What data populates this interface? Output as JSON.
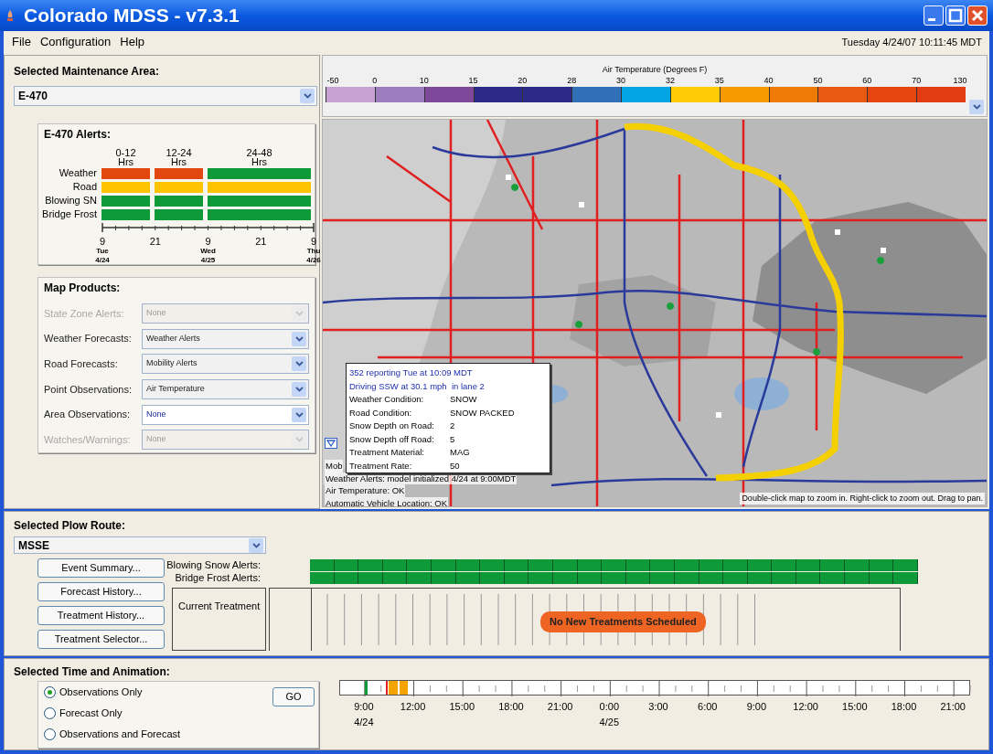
{
  "window": {
    "title": "Colorado MDSS - v7.3.1"
  },
  "menu": [
    "File",
    "Configuration",
    "Help"
  ],
  "datetime": "Tuesday 4/24/07 10:11:45 MDT",
  "maintenance_area": {
    "label": "Selected Maintenance Area:",
    "value": "E-470"
  },
  "alerts": {
    "title": "E-470 Alerts:",
    "columns": [
      {
        "range": "0-12",
        "unit": "Hrs"
      },
      {
        "range": "12-24",
        "unit": "Hrs"
      },
      {
        "range": "24-48",
        "unit": "Hrs"
      }
    ],
    "rows": [
      {
        "label": "Weather",
        "cells": [
          {
            "color": "#e2470f"
          },
          {
            "color": "#e2470f"
          },
          {
            "color": "#0f9a3a"
          }
        ]
      },
      {
        "label": "Road",
        "cells": [
          {
            "color": "#ffc400"
          },
          {
            "color": "#ffc400"
          },
          {
            "color": "#ffc400"
          }
        ]
      },
      {
        "label": "Blowing SN",
        "cells": [
          {
            "color": "#0f9a3a"
          },
          {
            "color": "#0f9a3a"
          },
          {
            "color": "#0f9a3a"
          }
        ]
      },
      {
        "label": "Bridge Frost",
        "cells": [
          {
            "color": "#0f9a3a"
          },
          {
            "color": "#0f9a3a"
          },
          {
            "color": "#0f9a3a"
          }
        ]
      }
    ],
    "axis": [
      {
        "hour": "9",
        "day": "Tue",
        "date": "4/24"
      },
      {
        "hour": "21"
      },
      {
        "hour": "9",
        "day": "Wed",
        "date": "4/25"
      },
      {
        "hour": "21"
      },
      {
        "hour": "9",
        "day": "Thu",
        "date": "4/26"
      }
    ]
  },
  "map_products": {
    "title": "Map Products:",
    "rows": [
      {
        "label": "State Zone Alerts:",
        "value": "None",
        "disabled": true,
        "focused": false
      },
      {
        "label": "Weather Forecasts:",
        "value": "Weather Alerts",
        "disabled": false,
        "focused": false
      },
      {
        "label": "Road Forecasts:",
        "value": "Mobility Alerts",
        "disabled": false,
        "focused": false
      },
      {
        "label": "Point Observations:",
        "value": "Air Temperature",
        "disabled": false,
        "focused": false
      },
      {
        "label": "Area Observations:",
        "value": "None",
        "disabled": false,
        "focused": true
      },
      {
        "label": "Watches/Warnings:",
        "value": "None",
        "disabled": true,
        "focused": false
      }
    ]
  },
  "legend": {
    "title": "Air Temperature (Degrees F)",
    "ticks": [
      "-50",
      "0",
      "10",
      "15",
      "20",
      "28",
      "30",
      "32",
      "35",
      "40",
      "50",
      "60",
      "70",
      "130"
    ],
    "bands": [
      {
        "color": "#c7a3d3"
      },
      {
        "color": "#9c7cbd"
      },
      {
        "color": "#7e489b"
      },
      {
        "color": "#2c2a88"
      },
      {
        "color": "#2c2a88"
      },
      {
        "color": "#3170b8"
      },
      {
        "color": "#03a6e2"
      },
      {
        "color": "#ffcb05"
      },
      {
        "color": "#f59a00"
      },
      {
        "color": "#ef7a05"
      },
      {
        "color": "#ea5a12"
      },
      {
        "color": "#e54610"
      },
      {
        "color": "#e23d12"
      }
    ]
  },
  "map": {
    "tooltip": {
      "header": [
        "352 reporting Tue at 10:09 MDT",
        "Driving SSW at 30.1 mph  in lane 2"
      ],
      "fields": [
        {
          "label": "Weather Condition:",
          "value": "SNOW"
        },
        {
          "label": "Road Condition:",
          "value": "SNOW PACKED"
        },
        {
          "label": "Snow Depth on Road:",
          "value": "2"
        },
        {
          "label": "Snow Depth off Road:",
          "value": "5"
        },
        {
          "label": "Treatment Material:",
          "value": "MAG"
        },
        {
          "label": "Treatment Rate:",
          "value": "50"
        }
      ]
    },
    "status": [
      "Mob",
      "Weather Alerts: model initialized 4/24 at 9:00MDT",
      "Air Temperature: OK",
      "Automatic Vehicle Location: OK"
    ],
    "hint": "Double-click map to zoom in. Right-click to zoom out. Drag to pan."
  },
  "plow_route": {
    "label": "Selected Plow Route:",
    "value": "MSSE",
    "buttons": [
      "Event Summary...",
      "Forecast History...",
      "Treatment History...",
      "Treatment Selector..."
    ],
    "alert_rows": [
      {
        "label": "Blowing Snow Alerts:",
        "cells": [
          {
            "color": "#0f9a3a"
          },
          {
            "color": "#0f9a3a"
          },
          {
            "color": "#0f9a3a"
          },
          {
            "color": "#0f9a3a"
          },
          {
            "color": "#0f9a3a"
          },
          {
            "color": "#0f9a3a"
          },
          {
            "color": "#0f9a3a"
          },
          {
            "color": "#0f9a3a"
          },
          {
            "color": "#0f9a3a"
          },
          {
            "color": "#0f9a3a"
          },
          {
            "color": "#0f9a3a"
          },
          {
            "color": "#0f9a3a"
          },
          {
            "color": "#0f9a3a"
          },
          {
            "color": "#0f9a3a"
          },
          {
            "color": "#0f9a3a"
          },
          {
            "color": "#0f9a3a"
          },
          {
            "color": "#0f9a3a"
          },
          {
            "color": "#0f9a3a"
          },
          {
            "color": "#0f9a3a"
          },
          {
            "color": "#0f9a3a"
          },
          {
            "color": "#0f9a3a"
          },
          {
            "color": "#0f9a3a"
          },
          {
            "color": "#0f9a3a"
          },
          {
            "color": "#0f9a3a"
          },
          {
            "color": "#0f9a3a"
          }
        ]
      },
      {
        "label": "Bridge Frost Alerts:",
        "cells": [
          {
            "color": "#0f9a3a"
          },
          {
            "color": "#0f9a3a"
          },
          {
            "color": "#0f9a3a"
          },
          {
            "color": "#0f9a3a"
          },
          {
            "color": "#0f9a3a"
          },
          {
            "color": "#0f9a3a"
          },
          {
            "color": "#0f9a3a"
          },
          {
            "color": "#0f9a3a"
          },
          {
            "color": "#0f9a3a"
          },
          {
            "color": "#0f9a3a"
          },
          {
            "color": "#0f9a3a"
          },
          {
            "color": "#0f9a3a"
          },
          {
            "color": "#0f9a3a"
          },
          {
            "color": "#0f9a3a"
          },
          {
            "color": "#0f9a3a"
          },
          {
            "color": "#0f9a3a"
          },
          {
            "color": "#0f9a3a"
          },
          {
            "color": "#0f9a3a"
          },
          {
            "color": "#0f9a3a"
          },
          {
            "color": "#0f9a3a"
          },
          {
            "color": "#0f9a3a"
          },
          {
            "color": "#0f9a3a"
          },
          {
            "color": "#0f9a3a"
          },
          {
            "color": "#0f9a3a"
          },
          {
            "color": "#0f9a3a"
          }
        ]
      }
    ],
    "current_treatment": "Current Treatment",
    "message": "No New Treatments Scheduled"
  },
  "time_animation": {
    "label": "Selected Time and Animation:",
    "modes": [
      {
        "label": "Observations Only",
        "selected": true
      },
      {
        "label": "Forecast Only",
        "selected": false
      },
      {
        "label": "Observations and Forecast",
        "selected": false
      }
    ],
    "go": "GO",
    "markers": [
      {
        "color": "#109a3a"
      },
      {
        "color": "#e02020"
      },
      {
        "color": "#f5a300"
      },
      {
        "color": "#f5a300"
      }
    ],
    "times": [
      {
        "time": "9:00",
        "date": "4/24"
      },
      {
        "time": "12:00"
      },
      {
        "time": "15:00"
      },
      {
        "time": "18:00"
      },
      {
        "time": "21:00"
      },
      {
        "time": "0:00",
        "date": "4/25"
      },
      {
        "time": "3:00"
      },
      {
        "time": "6:00"
      },
      {
        "time": "9:00"
      },
      {
        "time": "12:00"
      },
      {
        "time": "15:00"
      },
      {
        "time": "18:00"
      },
      {
        "time": "21:00"
      }
    ]
  }
}
